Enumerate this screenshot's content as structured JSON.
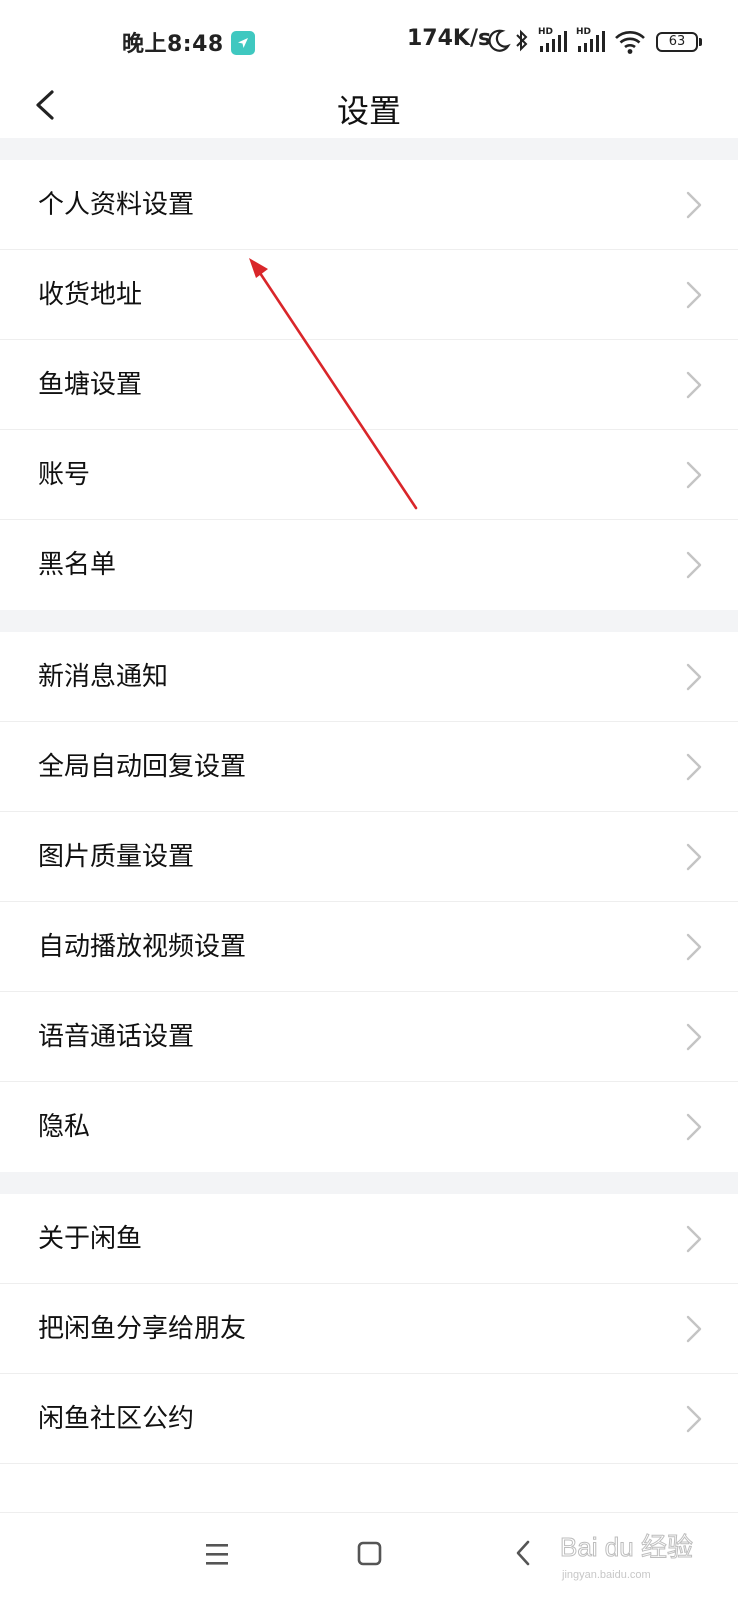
{
  "status_bar": {
    "time": "晚上8:48",
    "net_speed": "174K/s",
    "hd_label": "HD",
    "battery": "63",
    "icons": [
      "location-icon",
      "moon-icon",
      "bluetooth-icon",
      "signal-icon",
      "signal-icon",
      "wifi-icon",
      "battery-icon"
    ]
  },
  "header": {
    "title": "设置",
    "back_icon": "chevron-left-icon"
  },
  "settings": {
    "group1": [
      {
        "label": "个人资料设置"
      },
      {
        "label": "收货地址"
      },
      {
        "label": "鱼塘设置"
      },
      {
        "label": "账号"
      },
      {
        "label": "黑名单"
      }
    ],
    "group2": [
      {
        "label": "新消息通知"
      },
      {
        "label": "全局自动回复设置"
      },
      {
        "label": "图片质量设置"
      },
      {
        "label": "自动播放视频设置"
      },
      {
        "label": "语音通话设置"
      },
      {
        "label": "隐私"
      }
    ],
    "group3": [
      {
        "label": "关于闲鱼"
      },
      {
        "label": "把闲鱼分享给朋友"
      },
      {
        "label": "闲鱼社区公约"
      }
    ]
  },
  "system_nav": {
    "icons": [
      "menu-icon",
      "home-square-icon",
      "back-triangle-icon"
    ]
  },
  "watermark": {
    "text": "Bai du 经验",
    "subtext": "jingyan.baidu.com"
  },
  "colors": {
    "background": "#ffffff",
    "group_gap": "#f3f4f6",
    "divider": "#eeeeee",
    "text": "#111111",
    "chevron": "#c4c4c4",
    "annotation_arrow": "#d9262a",
    "location_badge": "#3fc8c0"
  }
}
